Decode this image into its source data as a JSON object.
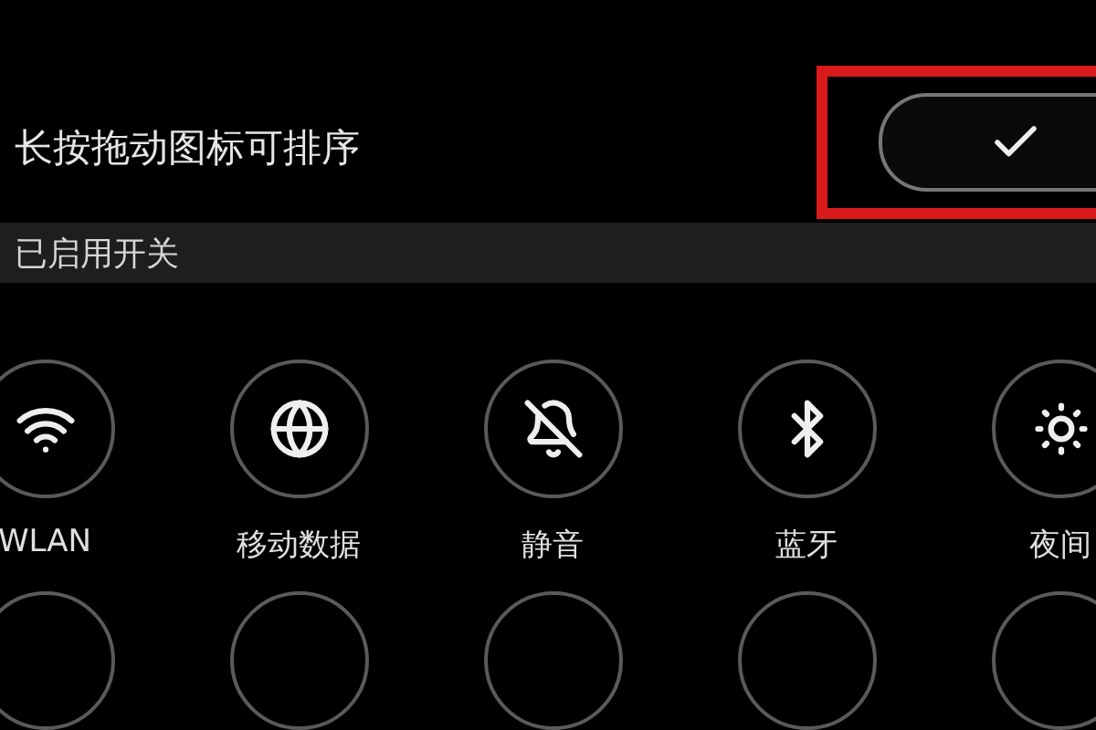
{
  "sort_row": {
    "label": "长按拖动图标可排序",
    "checked": true
  },
  "section": {
    "title": "已启用开关"
  },
  "toggles": [
    {
      "kind": "wifi",
      "label": "WLAN"
    },
    {
      "kind": "data",
      "label": "移动数据"
    },
    {
      "kind": "mute",
      "label": "静音"
    },
    {
      "kind": "bluetooth",
      "label": "蓝牙"
    },
    {
      "kind": "night",
      "label": "夜间"
    }
  ]
}
